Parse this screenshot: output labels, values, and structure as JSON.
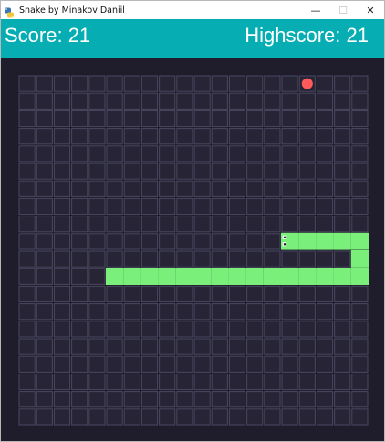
{
  "window": {
    "title": "Snake by Minakov Daniil",
    "controls": {
      "minimize": "—",
      "maximize": "☐",
      "close": "✕"
    }
  },
  "header": {
    "score_text": "Score: 21",
    "highscore_text": "Highscore: 21",
    "background_color": "#06aeb4"
  },
  "game": {
    "grid": {
      "columns": 20,
      "rows": 20
    },
    "colors": {
      "board_background": "#1f1d2b",
      "cell_fill": "#272535",
      "cell_border": "#4a4660",
      "snake": "#7af07a",
      "food": "#ff5b5b",
      "eye": "#1f1d2b"
    },
    "direction": "left",
    "food": {
      "col": 16,
      "row": 0
    },
    "snake": [
      {
        "col": 15,
        "row": 9
      },
      {
        "col": 16,
        "row": 9
      },
      {
        "col": 17,
        "row": 9
      },
      {
        "col": 18,
        "row": 9
      },
      {
        "col": 19,
        "row": 9
      },
      {
        "col": 19,
        "row": 10
      },
      {
        "col": 19,
        "row": 11
      },
      {
        "col": 18,
        "row": 11
      },
      {
        "col": 17,
        "row": 11
      },
      {
        "col": 16,
        "row": 11
      },
      {
        "col": 15,
        "row": 11
      },
      {
        "col": 14,
        "row": 11
      },
      {
        "col": 13,
        "row": 11
      },
      {
        "col": 12,
        "row": 11
      },
      {
        "col": 11,
        "row": 11
      },
      {
        "col": 10,
        "row": 11
      },
      {
        "col": 9,
        "row": 11
      },
      {
        "col": 8,
        "row": 11
      },
      {
        "col": 7,
        "row": 11
      },
      {
        "col": 6,
        "row": 11
      },
      {
        "col": 5,
        "row": 11
      }
    ]
  }
}
